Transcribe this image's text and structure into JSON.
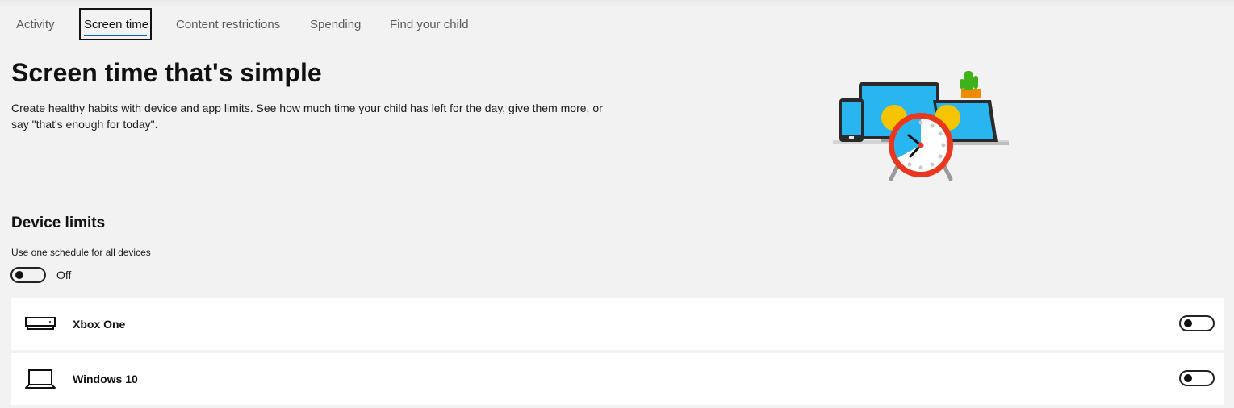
{
  "tabs": [
    {
      "label": "Activity",
      "active": false
    },
    {
      "label": "Screen time",
      "active": true
    },
    {
      "label": "Content restrictions",
      "active": false
    },
    {
      "label": "Spending",
      "active": false
    },
    {
      "label": "Find your child",
      "active": false
    }
  ],
  "hero": {
    "title": "Screen time that's simple",
    "description": "Create healthy habits with device and app limits. See how much time your child has left for the day, give them more, or say \"that's enough for today\".",
    "illustration": "devices-alarm-clock-illustration"
  },
  "device_limits": {
    "title": "Device limits",
    "schedule_label": "Use one schedule for all devices",
    "schedule_toggle_state": "Off",
    "schedule_toggle_on": false
  },
  "devices": [
    {
      "name": "Xbox One",
      "icon": "xbox-console-icon",
      "toggle_on": false
    },
    {
      "name": "Windows 10",
      "icon": "laptop-icon",
      "toggle_on": false
    }
  ],
  "colors": {
    "background": "#f2f2f2",
    "accent": "#0067b8",
    "card": "#ffffff",
    "clock_red": "#e8381f",
    "screen_blue": "#29b6f0",
    "bell_yellow": "#f7c400",
    "cactus_green": "#3fb21b"
  }
}
